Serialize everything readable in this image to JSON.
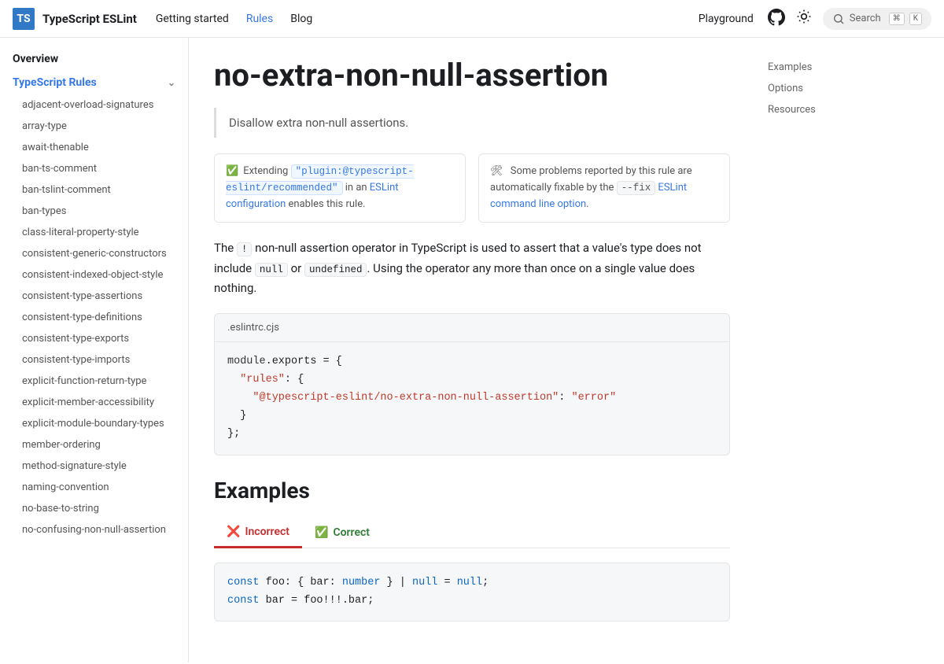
{
  "nav": {
    "brand": "TypeScript ESLint",
    "links": [
      "Getting started",
      "Rules",
      "Blog"
    ],
    "active_index": 1,
    "playground": "Playground",
    "search": "Search",
    "kbd1": "⌘",
    "kbd2": "K"
  },
  "sidebar": {
    "overview": "Overview",
    "category": "TypeScript Rules",
    "items": [
      "adjacent-overload-signatures",
      "array-type",
      "await-thenable",
      "ban-ts-comment",
      "ban-tslint-comment",
      "ban-types",
      "class-literal-property-style",
      "consistent-generic-constructors",
      "consistent-indexed-object-style",
      "consistent-type-assertions",
      "consistent-type-definitions",
      "consistent-type-exports",
      "consistent-type-imports",
      "explicit-function-return-type",
      "explicit-member-accessibility",
      "explicit-module-boundary-types",
      "member-ordering",
      "method-signature-style",
      "naming-convention",
      "no-base-to-string",
      "no-confusing-non-null-assertion"
    ]
  },
  "page": {
    "title": "no-extra-non-null-assertion",
    "summary": "Disallow extra non-null assertions.",
    "adm1": {
      "prefix": "Extending ",
      "code": "\"plugin:@typescript-eslint/recommended\"",
      "middle": " in an ",
      "link": "ESLint configuration",
      "suffix": " enables this rule."
    },
    "adm2": {
      "icon": "🛠",
      "prefix": " Some problems reported by this rule are automatically fixable by the ",
      "code": "--fix",
      "link": " ESLint command line option",
      "suffix": "."
    },
    "para": {
      "p1": "The ",
      "c1": "!",
      "p2": " non-null assertion operator in TypeScript is used to assert that a value's type does not include ",
      "c2": "null",
      "p3": " or ",
      "c3": "undefined",
      "p4": ". Using the operator any more than once on a single value does nothing."
    },
    "code_title": ".eslintrc.cjs",
    "code": {
      "l1a": "module",
      "l1b": ".exports = {",
      "l2a": "  ",
      "l2b": "\"rules\"",
      "l2c": ": {",
      "l3a": "    ",
      "l3b": "\"@typescript-eslint/no-extra-non-null-assertion\"",
      "l3c": ": ",
      "l3d": "\"error\"",
      "l4": "  }",
      "l5": "};"
    },
    "examples_heading": "Examples",
    "tabs": {
      "incorrect": "Incorrect",
      "correct": "Correct"
    },
    "example": {
      "l1a": "const",
      "l1b": " foo: { bar: ",
      "l1c": "number",
      "l1d": " } | ",
      "l1e": "null",
      "l1f": " = ",
      "l1g": "null",
      "l1h": ";",
      "l2a": "const",
      "l2b": " bar = foo!!!.bar;"
    }
  },
  "toc": [
    "Examples",
    "Options",
    "Resources"
  ]
}
